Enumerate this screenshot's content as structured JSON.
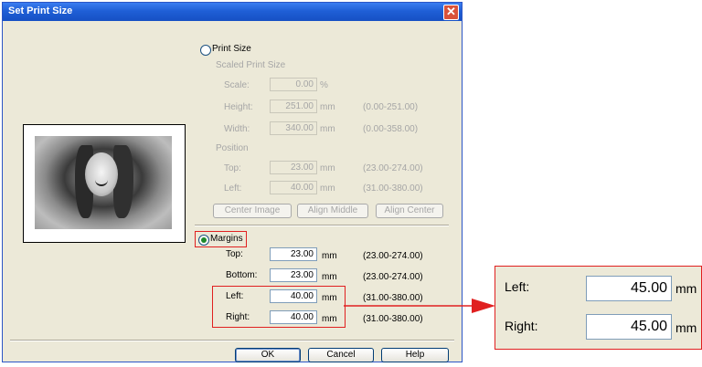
{
  "window": {
    "title": "Set Print Size"
  },
  "print_size": {
    "radio_label": "Print Size",
    "group_label": "Scaled Print Size",
    "scale": {
      "label": "Scale:",
      "value": "0.00",
      "unit": "%"
    },
    "height": {
      "label": "Height:",
      "value": "251.00",
      "unit": "mm",
      "range": "(0.00-251.00)"
    },
    "width": {
      "label": "Width:",
      "value": "340.00",
      "unit": "mm",
      "range": "(0.00-358.00)"
    },
    "position_label": "Position",
    "top": {
      "label": "Top:",
      "value": "23.00",
      "unit": "mm",
      "range": "(23.00-274.00)"
    },
    "left": {
      "label": "Left:",
      "value": "40.00",
      "unit": "mm",
      "range": "(31.00-380.00)"
    },
    "buttons": {
      "center_image": "Center Image",
      "align_middle": "Align Middle",
      "align_center": "Align Center"
    }
  },
  "margins": {
    "radio_label": "Margins",
    "top": {
      "label": "Top:",
      "value": "23.00",
      "unit": "mm",
      "range": "(23.00-274.00)"
    },
    "bottom": {
      "label": "Bottom:",
      "value": "23.00",
      "unit": "mm",
      "range": "(23.00-274.00)"
    },
    "left": {
      "label": "Left:",
      "value": "40.00",
      "unit": "mm",
      "range": "(31.00-380.00)"
    },
    "right": {
      "label": "Right:",
      "value": "40.00",
      "unit": "mm",
      "range": "(31.00-380.00)"
    }
  },
  "footer": {
    "ok": "OK",
    "cancel": "Cancel",
    "help": "Help"
  },
  "zoom_callout": {
    "left": {
      "label": "Left:",
      "value": "45.00",
      "unit": "mm"
    },
    "right": {
      "label": "Right:",
      "value": "45.00",
      "unit": "mm"
    }
  },
  "colors": {
    "highlight": "#e02020",
    "titlebar": "#1f5fd6",
    "radio_selected": "#1e8a2b"
  }
}
